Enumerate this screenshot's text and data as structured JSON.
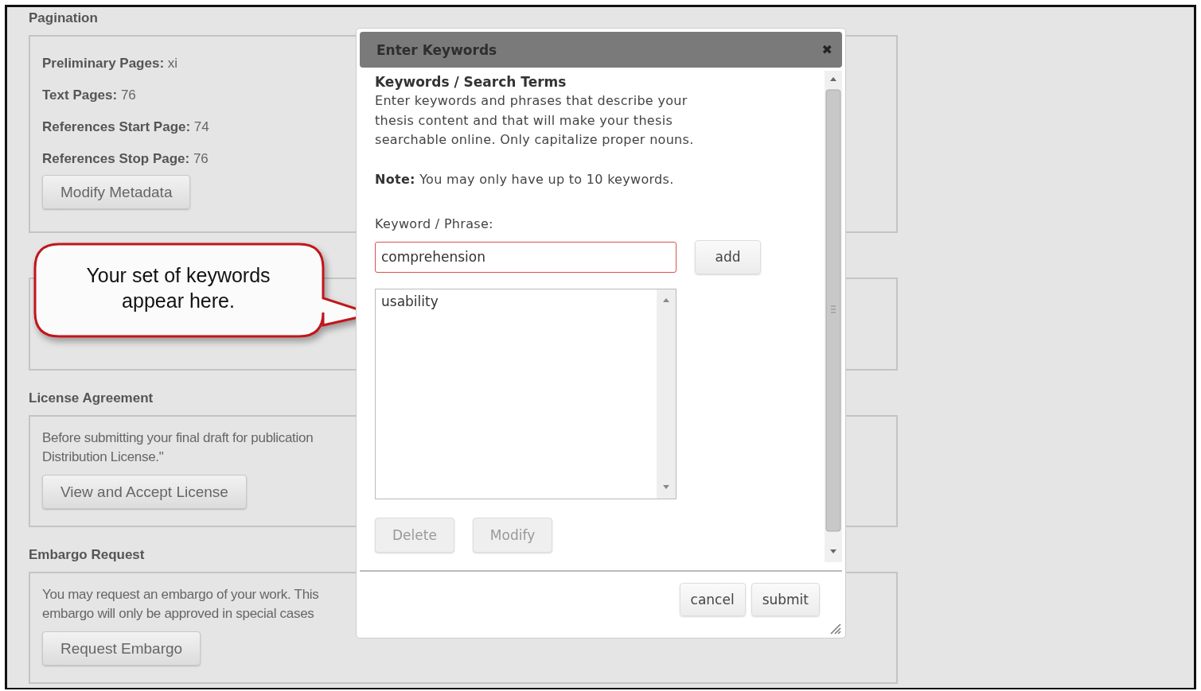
{
  "sections": [
    {
      "kind": "fields",
      "title": "Pagination",
      "fields": [
        {
          "label": "Preliminary Pages:",
          "value": "xi"
        },
        {
          "label": "Text Pages:",
          "value": "76"
        },
        {
          "label": "References Start Page:",
          "value": "74"
        },
        {
          "label": "References Stop Page:",
          "value": "76"
        }
      ],
      "button": "Modify Metadata"
    },
    {
      "kind": "covered"
    },
    {
      "kind": "text",
      "title": "License Agreement",
      "lines": [
        "Before submitting your final draft for publication",
        "Distribution License.\""
      ],
      "button": "View and Accept License"
    },
    {
      "kind": "text",
      "title": "Embargo Request",
      "lines": [
        "You may request an embargo of your work. This",
        "embargo will only be approved in special cases"
      ],
      "button": "Request Embargo"
    }
  ],
  "callout": {
    "lines": [
      "Your set of keywords",
      "appear here."
    ]
  },
  "dialog": {
    "title": "Enter Keywords",
    "close": "✖",
    "heading": "Keywords / Search Terms",
    "description": [
      "Enter keywords and phrases that describe your",
      "thesis content and that will make your thesis",
      "searchable online. Only capitalize proper nouns."
    ],
    "note": "**Note:** You may only have up to 10 keywords.",
    "field_label": "Keyword / Phrase:",
    "field_value": "comprehension",
    "add_button": "add",
    "keywords": [
      {
        "text": "usability",
        "selected": false
      }
    ],
    "list_buttons": [
      {
        "label": "Delete",
        "disabled": true
      },
      {
        "label": "Modify",
        "disabled": true
      }
    ],
    "footer_buttons": [
      "cancel",
      "submit"
    ]
  }
}
